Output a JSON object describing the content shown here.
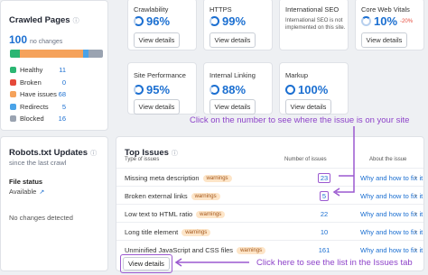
{
  "crawled": {
    "title": "Crawled Pages",
    "total": "100",
    "total_suffix": "no changes",
    "legend": [
      {
        "label": "Healthy",
        "count": "11",
        "color": "#2bb673"
      },
      {
        "label": "Broken",
        "count": "0",
        "color": "#e5493a"
      },
      {
        "label": "Have issues",
        "count": "68",
        "color": "#f5a25b"
      },
      {
        "label": "Redirects",
        "count": "5",
        "color": "#4aa3e8"
      },
      {
        "label": "Blocked",
        "count": "16",
        "color": "#9aa3b1"
      }
    ]
  },
  "metrics": [
    {
      "label": "Crawlability",
      "value": "96%",
      "button": "View details"
    },
    {
      "label": "HTTPS",
      "value": "99%",
      "button": "View details"
    },
    {
      "label": "International SEO",
      "value": "",
      "note": "International SEO is not implemented on this site.",
      "button": ""
    },
    {
      "label": "Core Web Vitals",
      "value": "10%",
      "change": "-20%",
      "button": "View details"
    },
    {
      "label": "Site Performance",
      "value": "95%",
      "button": "View details"
    },
    {
      "label": "Internal Linking",
      "value": "88%",
      "button": "View details"
    },
    {
      "label": "Markup",
      "value": "100%",
      "button": "View details"
    }
  ],
  "robots": {
    "title": "Robots.txt Updates",
    "subtitle": "since the last crawl",
    "file_status_label": "File status",
    "file_status_value": "Available",
    "no_changes": "No changes detected"
  },
  "issues": {
    "title": "Top Issues",
    "col_type": "Type of issues",
    "col_number": "Number of issues",
    "col_about": "About the issue",
    "rows": [
      {
        "name": "Missing meta description",
        "badge": "warnings",
        "count": "23",
        "fix": "Why and how to fix it"
      },
      {
        "name": "Broken external links",
        "badge": "warnings",
        "count": "5",
        "fix": "Why and how to fix it"
      },
      {
        "name": "Low text to HTML ratio",
        "badge": "warnings",
        "count": "22",
        "fix": "Why and how to fix it"
      },
      {
        "name": "Long title element",
        "badge": "warnings",
        "count": "10",
        "fix": "Why and how to fix it"
      },
      {
        "name": "Unminified JavaScript and CSS files",
        "badge": "warnings",
        "count": "161",
        "fix": "Why and how to fix it"
      }
    ],
    "view_details": "View details"
  },
  "annotations": {
    "top": "Click on the number to see where the issue is on your site",
    "bottom": "Click here to see the list in the Issues tab"
  },
  "colors": {
    "accent": "#1b6fd1",
    "annotation": "#8e44c9"
  }
}
